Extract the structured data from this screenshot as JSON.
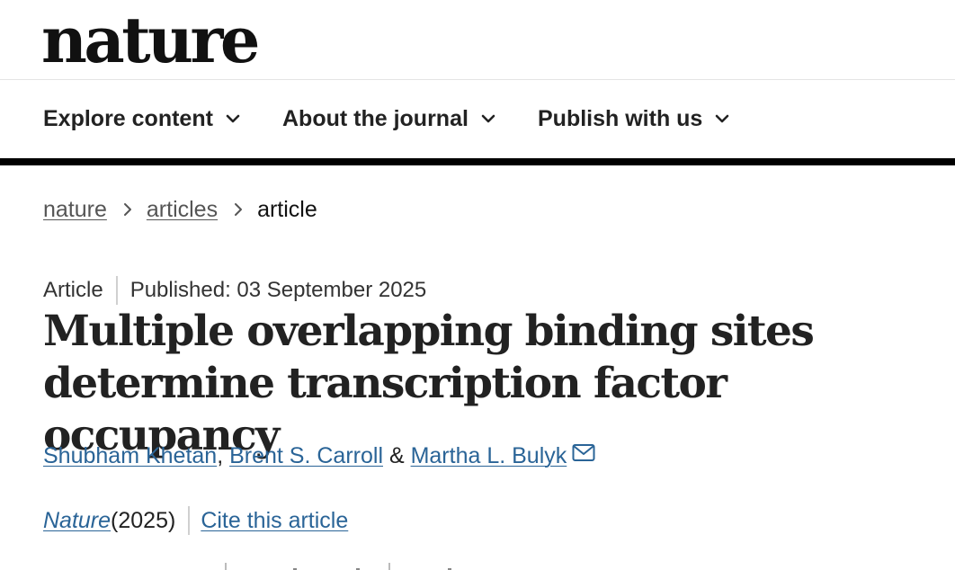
{
  "site": {
    "logo": "nature"
  },
  "nav": {
    "items": [
      {
        "label": "Explore content"
      },
      {
        "label": "About the journal"
      },
      {
        "label": "Publish with us"
      }
    ]
  },
  "breadcrumbs": {
    "items": [
      {
        "label": "nature"
      },
      {
        "label": "articles"
      },
      {
        "label": "article"
      }
    ]
  },
  "article": {
    "type": "Article",
    "published": "Published: 03 September 2025",
    "title": "Multiple overlapping binding sites determine transcription factor occupancy",
    "authors": [
      {
        "name": "Shubham Khetan",
        "after": ", "
      },
      {
        "name": "Brent S. Carroll",
        "after": " & "
      },
      {
        "name": "Martha L. Bulyk",
        "after": ""
      }
    ],
    "corresponding_icon": "mail-icon",
    "journal": "Nature",
    "year": " (2025)",
    "cite_label": "Cite this article"
  },
  "colors": {
    "link": "#2a6497",
    "breadcrumb_link": "#555555",
    "text": "#222222",
    "rule": "#000000"
  }
}
